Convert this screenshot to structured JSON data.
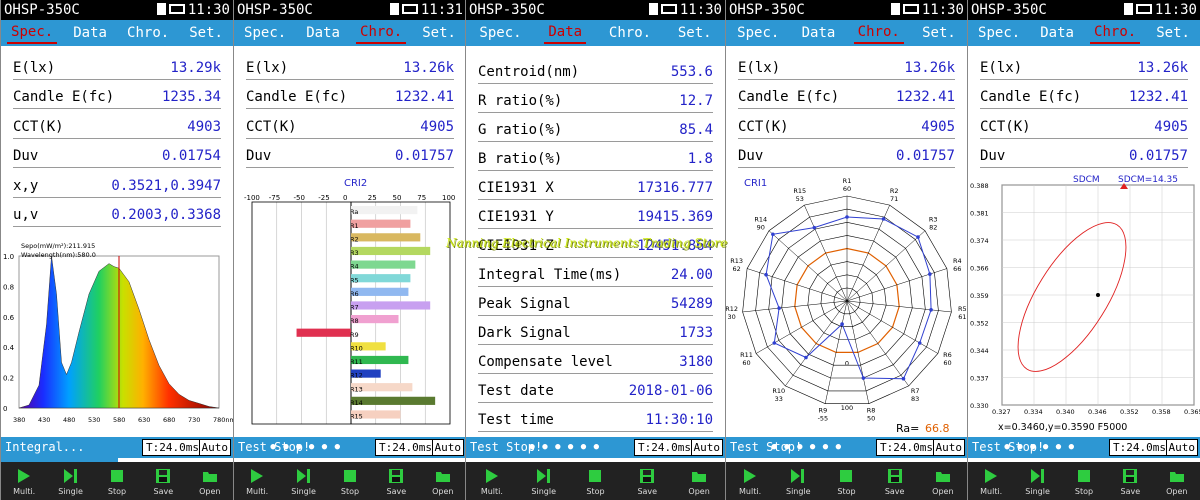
{
  "panels": [
    {
      "device": "OHSP-350C",
      "clock": "11:30",
      "tabs": [
        "Spec.",
        "Data",
        "Chro.",
        "Set."
      ],
      "active_tab": 0,
      "rows": [
        {
          "label": "E(lx)",
          "value": "13.29k"
        },
        {
          "label": "Candle E(fc)",
          "value": "1235.34"
        },
        {
          "label": "CCT(K)",
          "value": "4903"
        },
        {
          "label": "Duv",
          "value": "0.01754"
        },
        {
          "label": "x,y",
          "value": "0.3521,0.3947"
        },
        {
          "label": "u,v",
          "value": "0.2003,0.3368"
        }
      ],
      "status_text": "Integral...",
      "integration_time": "T:24.0ms",
      "auto_label": "Auto",
      "progress_fraction": 0.5
    },
    {
      "device": "OHSP-350C",
      "clock": "11:31",
      "tabs": [
        "Spec.",
        "Data",
        "Chro.",
        "Set."
      ],
      "active_tab": 2,
      "rows": [
        {
          "label": "E(lx)",
          "value": "13.26k"
        },
        {
          "label": "Candle E(fc)",
          "value": "1232.41"
        },
        {
          "label": "CCT(K)",
          "value": "4905"
        },
        {
          "label": "Duv",
          "value": "0.01757"
        }
      ],
      "status_text": "Test Stop!",
      "integration_time": "T:24.0ms",
      "auto_label": "Auto"
    },
    {
      "device": "OHSP-350C",
      "clock": "11:30",
      "tabs": [
        "Spec.",
        "Data",
        "Chro.",
        "Set."
      ],
      "active_tab": 1,
      "rows": [
        {
          "label": "Centroid(nm)",
          "value": "553.6"
        },
        {
          "label": "R ratio(%)",
          "value": "12.7"
        },
        {
          "label": "G ratio(%)",
          "value": "85.4"
        },
        {
          "label": "B ratio(%)",
          "value": "1.8"
        },
        {
          "label": "CIE1931 X",
          "value": "17316.777"
        },
        {
          "label": "CIE1931 Y",
          "value": "19415.369"
        },
        {
          "label": "CIE1931 Z",
          "value": "12451.864"
        },
        {
          "label": "Integral Time(ms)",
          "value": "24.00"
        },
        {
          "label": "Peak Signal",
          "value": "54289"
        },
        {
          "label": "Dark Signal",
          "value": "1733"
        },
        {
          "label": "Compensate level",
          "value": "3180"
        },
        {
          "label": "Test date",
          "value": "2018-01-06"
        },
        {
          "label": "Test time",
          "value": "11:30:10"
        }
      ],
      "status_text": "Test Stop!",
      "integration_time": "T:24.0ms",
      "auto_label": "Auto"
    },
    {
      "device": "OHSP-350C",
      "clock": "11:30",
      "tabs": [
        "Spec.",
        "Data",
        "Chro.",
        "Set."
      ],
      "active_tab": 2,
      "rows": [
        {
          "label": "E(lx)",
          "value": "13.26k"
        },
        {
          "label": "Candle E(fc)",
          "value": "1232.41"
        },
        {
          "label": "CCT(K)",
          "value": "4905"
        },
        {
          "label": "Duv",
          "value": "0.01757"
        }
      ],
      "status_text": "Test Stop!",
      "integration_time": "T:24.0ms",
      "auto_label": "Auto"
    },
    {
      "device": "OHSP-350C",
      "clock": "11:30",
      "tabs": [
        "Spec.",
        "Data",
        "Chro.",
        "Set."
      ],
      "active_tab": 2,
      "rows": [
        {
          "label": "E(lx)",
          "value": "13.26k"
        },
        {
          "label": "Candle E(fc)",
          "value": "1232.41"
        },
        {
          "label": "CCT(K)",
          "value": "4905"
        },
        {
          "label": "Duv",
          "value": "0.01757"
        }
      ],
      "status_text": "Test Stop!",
      "integration_time": "T:24.0ms",
      "auto_label": "Auto"
    }
  ],
  "toolbar": [
    {
      "label": "Multi.",
      "icon": "play-icon"
    },
    {
      "label": "Single",
      "icon": "step-icon"
    },
    {
      "label": "Stop",
      "icon": "stop-icon"
    },
    {
      "label": "Save",
      "icon": "save-icon"
    },
    {
      "label": "Open",
      "icon": "open-folder-icon"
    }
  ],
  "page_dots": "● ● ● ● ● ●",
  "watermark": "Nanning Electrical Instruments Trading Store",
  "colors": {
    "tab_bar": "#2d97d3",
    "value_text": "#2323c8",
    "active_tab": "#cc0000",
    "title_bar": "#000000"
  },
  "chart_data": [
    {
      "type": "area",
      "legend_line1": "Sepo(mW/m²):211.915",
      "legend_line2": "Wavelength(nm):580.0",
      "x_ticks": [
        "380",
        "430",
        "480",
        "530",
        "580",
        "630",
        "680",
        "730",
        "780nm"
      ],
      "y_ticks": [
        "1.0",
        "0.8",
        "0.6",
        "0.4",
        "0.2",
        "0"
      ],
      "xlim": [
        380,
        780
      ],
      "ylim": [
        0,
        1
      ],
      "x": [
        380,
        400,
        420,
        435,
        445,
        455,
        465,
        475,
        485,
        500,
        520,
        540,
        560,
        570,
        580,
        600,
        620,
        640,
        660,
        680,
        700,
        720,
        740,
        760,
        780
      ],
      "y": [
        0.0,
        0.02,
        0.15,
        0.55,
        1.0,
        0.75,
        0.3,
        0.22,
        0.3,
        0.5,
        0.75,
        0.9,
        0.95,
        0.93,
        0.92,
        0.83,
        0.65,
        0.45,
        0.28,
        0.16,
        0.09,
        0.05,
        0.03,
        0.01,
        0.0
      ]
    },
    {
      "type": "bar",
      "title": "CRI2",
      "x_ticks": [
        "-100",
        "-75",
        "-50",
        "-25",
        "0",
        "25",
        "50",
        "75",
        "100"
      ],
      "xlim": [
        -100,
        100
      ],
      "categories": [
        "Ra",
        "R1",
        "R2",
        "R3",
        "R4",
        "R5",
        "R6",
        "R7",
        "R8",
        "R9",
        "R10",
        "R11",
        "R12",
        "R13",
        "R14",
        "R15"
      ],
      "values": [
        67,
        60,
        70,
        80,
        65,
        60,
        58,
        80,
        48,
        -55,
        35,
        58,
        30,
        62,
        85,
        50
      ],
      "bar_colors": [
        "#f2f2f2",
        "#f0a0a0",
        "#d9b860",
        "#b4d860",
        "#7ed890",
        "#80d8d8",
        "#90b8f0",
        "#c8a0f0",
        "#f0a0d0",
        "#e03050",
        "#f0e040",
        "#30b850",
        "#2040c0",
        "#f6d8c8",
        "#5a7a30",
        "#f6d0c0"
      ]
    },
    {
      "type": "radar",
      "title": "CRI1",
      "categories": [
        "R1",
        "R2",
        "R3",
        "R4",
        "R5",
        "R6",
        "R7",
        "R8",
        "R9",
        "R10",
        "R11",
        "R12",
        "R13",
        "R14",
        "R15"
      ],
      "values": [
        60,
        71,
        82,
        66,
        61,
        60,
        83,
        50,
        -55,
        33,
        60,
        30,
        62,
        90,
        53
      ],
      "value_labels": [
        "60",
        "71",
        "82",
        "66",
        "61",
        "60",
        "83",
        "50",
        "-55",
        "33",
        "60",
        "30",
        "62",
        "90",
        "53"
      ],
      "ra_label": "Ra=",
      "ra_value": "66.8",
      "ring_labels": [
        "0",
        "100"
      ]
    },
    {
      "type": "scatter",
      "title": "SDCM",
      "sdcm_label": "SDCM=14.35",
      "y_ticks": [
        "0.388",
        "0.381",
        "0.374",
        "0.366",
        "0.359",
        "0.352",
        "0.344",
        "0.337",
        "0.330"
      ],
      "x_ticks": [
        "0.327",
        "0.334",
        "0.340",
        "0.346",
        "0.352",
        "0.358",
        "0.365"
      ],
      "xlim": [
        0.327,
        0.365
      ],
      "ylim": [
        0.33,
        0.388
      ],
      "point": {
        "x": 0.346,
        "y": 0.359
      },
      "readout": "x=0.3460,y=0.3590 F5000"
    }
  ]
}
